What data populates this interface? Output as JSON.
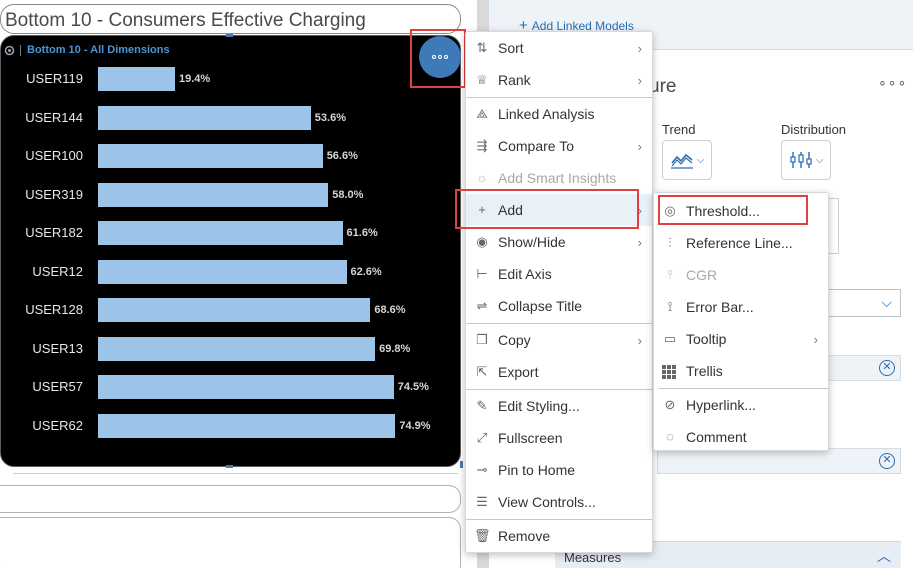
{
  "chart_title": "Bottom 10 - Consumers Effective Charging",
  "chart": {
    "subtitle": "Bottom 10 - All Dimensions",
    "subtitle_icon": "hierarchy-icon"
  },
  "chart_data": {
    "type": "bar",
    "orientation": "horizontal",
    "title": "Bottom 10 - Consumers Effective Charging",
    "subtitle": "Bottom 10 - All Dimensions",
    "categories": [
      "USER119",
      "USER144",
      "USER100",
      "USER319",
      "USER182",
      "USER12",
      "USER128",
      "USER13",
      "USER57",
      "USER62"
    ],
    "values": [
      19.4,
      53.6,
      56.6,
      58.0,
      61.6,
      62.6,
      68.6,
      69.8,
      74.5,
      74.9
    ],
    "value_labels": [
      "19.4%",
      "53.6%",
      "56.6%",
      "58.0%",
      "61.6%",
      "62.6%",
      "68.6%",
      "69.8%",
      "74.5%",
      "74.9%"
    ],
    "unit": "%",
    "bar_color": "#9cc3e8",
    "background": "#000000",
    "grid": false,
    "legend": "none"
  },
  "main_menu": {
    "items": [
      {
        "label": "Sort",
        "icon": "sort-icon",
        "submenu": true,
        "disabled": false
      },
      {
        "label": "Rank",
        "icon": "trophy-icon",
        "submenu": true,
        "disabled": false
      },
      {
        "label": "Linked Analysis",
        "icon": "linked-analysis-icon",
        "submenu": false,
        "disabled": false
      },
      {
        "label": "Compare To",
        "icon": "compare-icon",
        "submenu": true,
        "disabled": false
      },
      {
        "label": "Add Smart Insights",
        "icon": "lightbulb-icon",
        "submenu": false,
        "disabled": true
      },
      {
        "label": "Add",
        "icon": "plus-icon",
        "submenu": true,
        "disabled": false,
        "active": true
      },
      {
        "label": "Show/Hide",
        "icon": "eye-icon",
        "submenu": true,
        "disabled": false
      },
      {
        "label": "Edit Axis",
        "icon": "axis-icon",
        "submenu": false,
        "disabled": false
      },
      {
        "label": "Collapse Title",
        "icon": "collapse-title-icon",
        "submenu": false,
        "disabled": false
      },
      {
        "label": "Copy",
        "icon": "copy-icon",
        "submenu": true,
        "disabled": false
      },
      {
        "label": "Export",
        "icon": "export-icon",
        "submenu": false,
        "disabled": false
      },
      {
        "label": "Edit Styling...",
        "icon": "brush-icon",
        "submenu": false,
        "disabled": false
      },
      {
        "label": "Fullscreen",
        "icon": "fullscreen-icon",
        "submenu": false,
        "disabled": false
      },
      {
        "label": "Pin to Home",
        "icon": "pin-icon",
        "submenu": false,
        "disabled": false
      },
      {
        "label": "View Controls...",
        "icon": "controls-icon",
        "submenu": false,
        "disabled": false
      },
      {
        "label": "Remove",
        "icon": "trash-icon",
        "submenu": false,
        "disabled": false
      }
    ]
  },
  "add_submenu": {
    "items": [
      {
        "label": "Threshold...",
        "icon": "threshold-icon",
        "submenu": false,
        "disabled": false
      },
      {
        "label": "Reference Line...",
        "icon": "reference-line-icon",
        "submenu": false,
        "disabled": false
      },
      {
        "label": "CGR",
        "icon": "cgr-icon",
        "submenu": false,
        "disabled": true
      },
      {
        "label": "Error Bar...",
        "icon": "error-bar-icon",
        "submenu": false,
        "disabled": false
      },
      {
        "label": "Tooltip",
        "icon": "tooltip-icon",
        "submenu": true,
        "disabled": false
      },
      {
        "label": "Trellis",
        "icon": "trellis-icon",
        "submenu": false,
        "disabled": false
      },
      {
        "label": "Hyperlink...",
        "icon": "link-icon",
        "submenu": false,
        "disabled": false
      },
      {
        "label": "Comment",
        "icon": "comment-icon",
        "submenu": false,
        "disabled": false
      }
    ]
  },
  "builder_panel": {
    "add_linked_models": "Add Linked Models",
    "section_heading": "ure",
    "trend_label": "Trend",
    "distribution_label": "Distribution",
    "measures_label": "Measures"
  },
  "colors": {
    "accent": "#2a6cb0",
    "highlight": "#e04040",
    "bar": "#9cc3e8",
    "subtitle": "#4a95d6",
    "more_button": "#3f7ab8"
  }
}
